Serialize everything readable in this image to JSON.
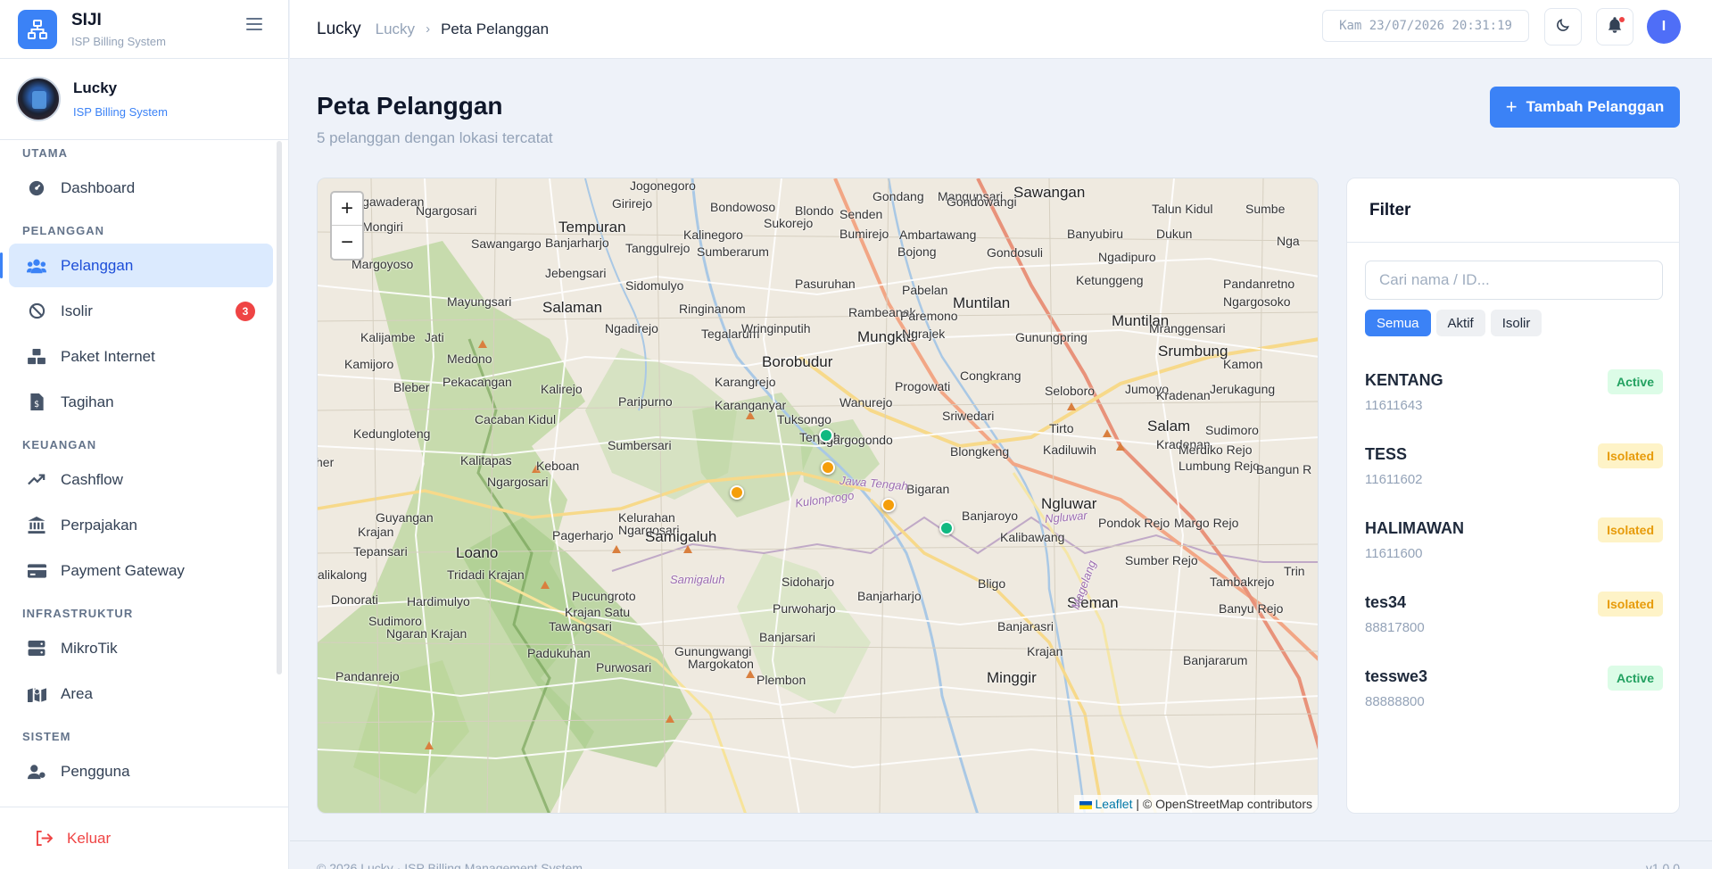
{
  "brand": {
    "name": "SIJI",
    "subtitle": "ISP Billing System"
  },
  "user": {
    "name": "Lucky",
    "role": "ISP Billing System"
  },
  "sidebar": {
    "sections": [
      {
        "label": "UTAMA",
        "items": [
          {
            "label": "Dashboard",
            "icon": "dashboard-icon"
          }
        ]
      },
      {
        "label": "PELANGGAN",
        "items": [
          {
            "label": "Pelanggan",
            "icon": "users-icon",
            "active": true
          },
          {
            "label": "Isolir",
            "icon": "ban-icon",
            "badge": "3"
          },
          {
            "label": "Paket Internet",
            "icon": "cubes-icon"
          },
          {
            "label": "Tagihan",
            "icon": "invoice-icon"
          }
        ]
      },
      {
        "label": "KEUANGAN",
        "items": [
          {
            "label": "Cashflow",
            "icon": "trend-icon"
          },
          {
            "label": "Perpajakan",
            "icon": "bank-icon"
          },
          {
            "label": "Payment Gateway",
            "icon": "card-icon"
          }
        ]
      },
      {
        "label": "INFRASTRUKTUR",
        "items": [
          {
            "label": "MikroTik",
            "icon": "server-icon"
          },
          {
            "label": "Area",
            "icon": "map-icon"
          }
        ]
      },
      {
        "label": "SISTEM",
        "items": [
          {
            "label": "Pengguna",
            "icon": "user-cog-icon"
          }
        ]
      }
    ],
    "logout": "Keluar"
  },
  "topbar": {
    "title": "Lucky",
    "crumb": "Lucky",
    "current": "Peta Pelanggan",
    "clock": "Kam 23/07/2026 20:31:19",
    "avatar_initial": "I"
  },
  "page": {
    "title": "Peta Pelanggan",
    "subtitle": "5 pelanggan dengan lokasi tercatat",
    "add_button": "Tambah Pelanggan"
  },
  "map": {
    "zoom_in": "+",
    "zoom_out": "−",
    "attribution_link": "Leaflet",
    "attribution_text": "| © OpenStreetMap contributors",
    "labels": [
      "Jogonegoro",
      "Gondang",
      "Mangunsari",
      "Sawangan",
      "Talun Kidul",
      "Sumbe",
      "Ngawaderan",
      "Ngargosari",
      "Girirejo",
      "Bondowoso",
      "Blondo",
      "Senden",
      "Gondowangi",
      "Tempuran",
      "Sukorejo",
      "Bumirejo",
      "Ambartawang",
      "Banyubiru",
      "Dukun",
      "Nga",
      "Mongiri",
      "Kalinegoro",
      "Sawangargo",
      "Banjarharjo",
      "Tanggulrejo",
      "Sumberarum",
      "Bojong",
      "Gondosuli",
      "Ngadipuro",
      "Margoyoso",
      "Jebengsari",
      "Ketunggeng",
      "Sidomulyo",
      "Pasuruhan",
      "Pandanretno",
      "Mayungsari",
      "Pabelan",
      "Salaman",
      "Muntilan",
      "Ngargosoko",
      "Ringinanom",
      "Rambeanak",
      "Paremono",
      "Ngadirejo",
      "Tegalarum",
      "Wringinputih",
      "Muntilan",
      "Mranggensari",
      "Kalijambe",
      "Jati",
      "Mungkid",
      "Ngrajek",
      "Gunungpring",
      "Srumbung",
      "Medono",
      "Borobudur",
      "Kamon",
      "Kamijoro",
      "Pekacangan",
      "Karangrejo",
      "Progowati",
      "Congkrang",
      "Bleber",
      "Kalirejo",
      "Jumoyo",
      "Jerukagung",
      "Wanurejo",
      "Seloboro",
      "Kradenan",
      "Paripurno",
      "Karanganyar",
      "Cacaban Kidul",
      "Tuksongo",
      "Sriwedari",
      "Kedungloteng",
      "Tirto",
      "Salam",
      "Sudimoro",
      "Kradenan",
      "Tengah",
      "Sumbersari",
      "Ngargogondo",
      "Blongkeng",
      "Kalitapas",
      "Kadiluwih",
      "Merdiko Rejo",
      "her",
      "Keboan",
      "Bigaran",
      "Ngargosari",
      "Ngluwar",
      "Lumbung Rejo",
      "Bangun R",
      "Guyangan",
      "Kelurahan",
      "Banjaroyo",
      "Krajan",
      "Ngargosari",
      "Pondok Rejo",
      "Margo Rejo",
      "Tepansari",
      "Loano",
      "Pagerharjo",
      "Samigaluh",
      "Kalibawang",
      "alikalong",
      "Tridadi Krajan",
      "Sumber Rejo",
      "Tambakrejo",
      "Trin",
      "Sidoharjo",
      "Donorati",
      "Hardimulyo",
      "Pucungroto",
      "Banjarharjo",
      "Bligo",
      "Sleman",
      "Sudimoro",
      "Krajan Satu",
      "Purwoharjo",
      "Banjarasri",
      "Banyu Rejo",
      "Ngaran Krajan",
      "Tawangsari",
      "Banjarsari",
      "Gunungwangi",
      "Krajan",
      "Banjararum",
      "Padukuhan",
      "Margokaton",
      "Pandanrejo",
      "Purwosari",
      "Plembon",
      "Minggir"
    ],
    "region_labels": [
      "Jawa Tengah",
      "Kulonprogo",
      "Ngluwar",
      "Samigaluh",
      "Magelang"
    ]
  },
  "filter": {
    "title": "Filter",
    "search_placeholder": "Cari nama / ID...",
    "chips": [
      "Semua",
      "Aktif",
      "Isolir"
    ],
    "customers": [
      {
        "name": "KENTANG",
        "id": "11611643",
        "status": "Active"
      },
      {
        "name": "TESS",
        "id": "11611602",
        "status": "Isolated"
      },
      {
        "name": "HALIMAWAN",
        "id": "11611600",
        "status": "Isolated"
      },
      {
        "name": "tes34",
        "id": "88817800",
        "status": "Isolated"
      },
      {
        "name": "tesswe3",
        "id": "88888800",
        "status": "Active"
      }
    ]
  },
  "colors": {
    "accent": "#3b82f6",
    "active": "#10b981",
    "isolated": "#f59e0b",
    "danger": "#ef4444"
  },
  "footer": {
    "left": "© 2026 Lucky · ISP Billing Management System",
    "right": "v1.0.0"
  }
}
